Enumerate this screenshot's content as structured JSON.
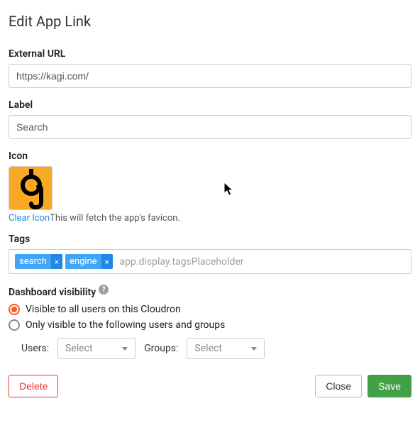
{
  "title": "Edit App Link",
  "fields": {
    "external_url": {
      "label": "External URL",
      "value": "https://kagi.com/"
    },
    "label_field": {
      "label": "Label",
      "value": "Search"
    },
    "icon_section": {
      "label": "Icon",
      "clear_text": "Clear Icon",
      "favicon_msg": "This will fetch the app's favicon.",
      "icon_name": "kagi-logo"
    },
    "tags": {
      "label": "Tags",
      "items": [
        {
          "label": "search"
        },
        {
          "label": "engine"
        }
      ],
      "placeholder": "app.display.tagsPlaceholder",
      "remove_glyph": "×"
    },
    "visibility": {
      "label": "Dashboard visibility",
      "option_all": "Visible to all users on this Cloudron",
      "option_restricted": "Only visible to the following users and groups",
      "selected": "all",
      "users_label": "Users:",
      "groups_label": "Groups:",
      "select_placeholder": "Select"
    }
  },
  "footer": {
    "delete": "Delete",
    "close": "Close",
    "save": "Save"
  },
  "help_glyph": "?"
}
